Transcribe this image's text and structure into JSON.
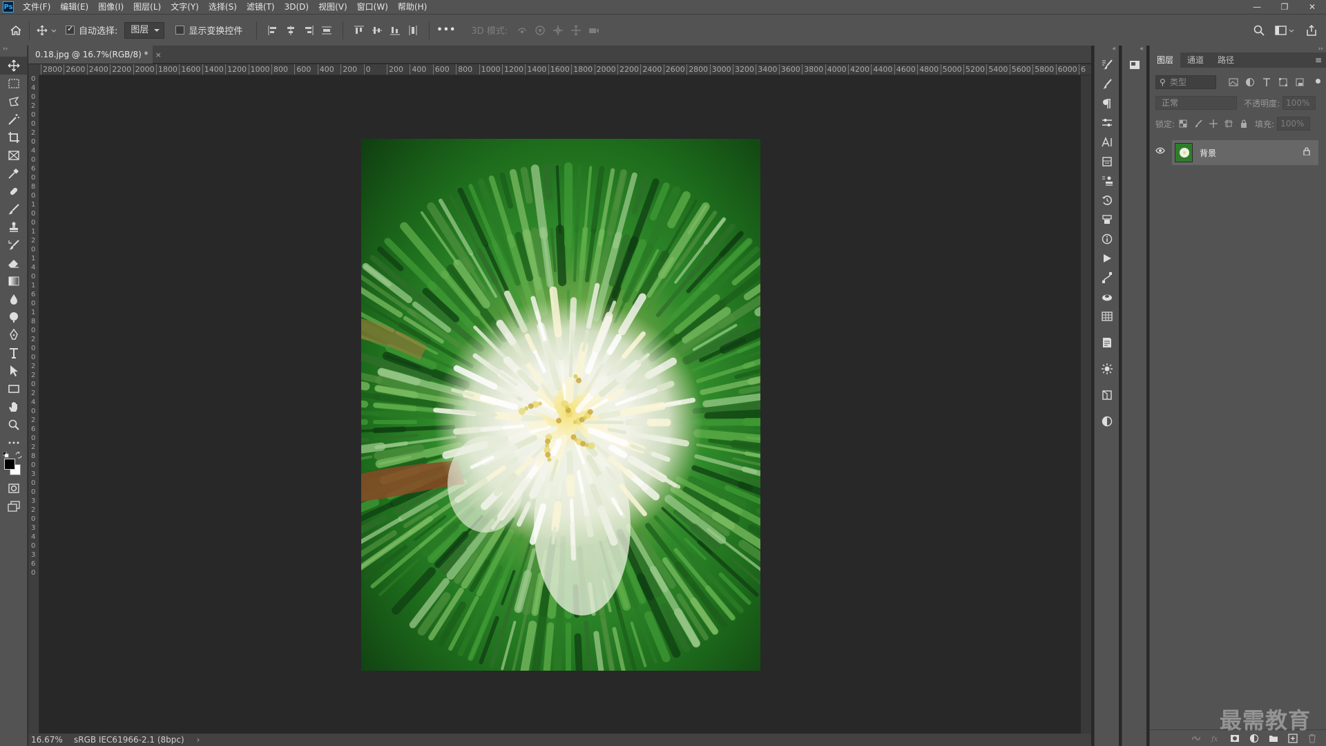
{
  "menubar": {
    "app_logo": "Ps",
    "items": [
      "文件(F)",
      "编辑(E)",
      "图像(I)",
      "图层(L)",
      "文字(Y)",
      "选择(S)",
      "滤镜(T)",
      "3D(D)",
      "视图(V)",
      "窗口(W)",
      "帮助(H)"
    ],
    "window_controls": [
      "—",
      "❐",
      "✕"
    ]
  },
  "options": {
    "auto_select_label": "自动选择:",
    "auto_select_checked": true,
    "target_value": "图层",
    "show_transform_label": "显示变换控件",
    "mode_3d_label": "3D 模式:",
    "more_label": "•••"
  },
  "document": {
    "tab_title": "0.18.jpg @ 16.7%(RGB/8) *",
    "tab_close": "×",
    "ruler_h": [
      "2800",
      "2600",
      "2400",
      "2200",
      "2000",
      "1800",
      "1600",
      "1400",
      "1200",
      "1000",
      "800",
      "600",
      "400",
      "200",
      "0",
      "200",
      "400",
      "600",
      "800",
      "1000",
      "1200",
      "1400",
      "1600",
      "1800",
      "2000",
      "2200",
      "2400",
      "2600",
      "2800",
      "3000",
      "3200",
      "3400",
      "3600",
      "3800",
      "4000",
      "4200",
      "4400",
      "4600",
      "4800",
      "5000",
      "5200",
      "5400",
      "5600",
      "5800",
      "6000",
      "6"
    ],
    "ruler_v": [
      "0",
      "4",
      "0",
      "2",
      "0",
      "0",
      "2",
      "0",
      "4",
      "0",
      "6",
      "0",
      "8",
      "0",
      "1",
      "0",
      "0",
      "1",
      "2",
      "0",
      "1",
      "4",
      "0",
      "1",
      "6",
      "0",
      "1",
      "8",
      "0",
      "2",
      "0",
      "0",
      "2",
      "2",
      "0",
      "2",
      "4",
      "0",
      "2",
      "6",
      "0",
      "2",
      "8",
      "0",
      "3",
      "0",
      "0",
      "3",
      "2",
      "0",
      "3",
      "4",
      "0",
      "3",
      "6",
      "0"
    ]
  },
  "status": {
    "zoom": "16.67%",
    "profile": "sRGB IEC61966-2.1 (8bpc)",
    "arrow": "›"
  },
  "layers_panel": {
    "tabs": [
      "图层",
      "通道",
      "路径"
    ],
    "filter_placeholder": "类型",
    "blend_mode": "正常",
    "opacity_label": "不透明度:",
    "opacity_value": "100%",
    "lock_label": "锁定:",
    "fill_label": "填充:",
    "fill_value": "100%",
    "layers": [
      {
        "name": "背景",
        "visible": true,
        "locked": true
      }
    ]
  },
  "watermark": "最需教育",
  "colors": {
    "accent": "#31a8ff",
    "panel_bg": "#535353",
    "canvas_bg": "#282828",
    "foreground_swatch": "#000000",
    "background_swatch": "#ffffff"
  }
}
